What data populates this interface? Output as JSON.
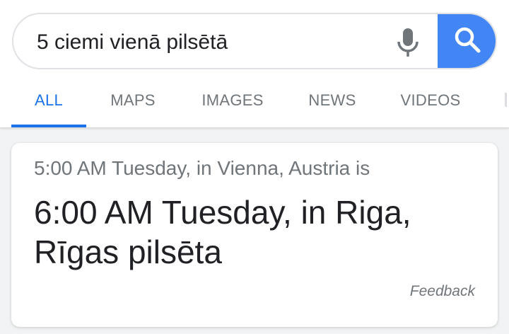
{
  "search": {
    "query": "5 ciemi vienā pilsētā",
    "mic_icon": "microphone-icon",
    "search_icon": "magnifier-icon",
    "accent_color": "#4285f4"
  },
  "tabs": [
    {
      "label": "ALL",
      "active": true
    },
    {
      "label": "MAPS",
      "active": false
    },
    {
      "label": "IMAGES",
      "active": false
    },
    {
      "label": "NEWS",
      "active": false
    },
    {
      "label": "VIDEOS",
      "active": false
    }
  ],
  "result": {
    "from": "5:00 AM Tuesday, in Vienna, Austria is",
    "to_line1": "6:00 AM Tuesday, in Riga,",
    "to_line2": "Rīgas pilsēta",
    "feedback_label": "Feedback"
  }
}
